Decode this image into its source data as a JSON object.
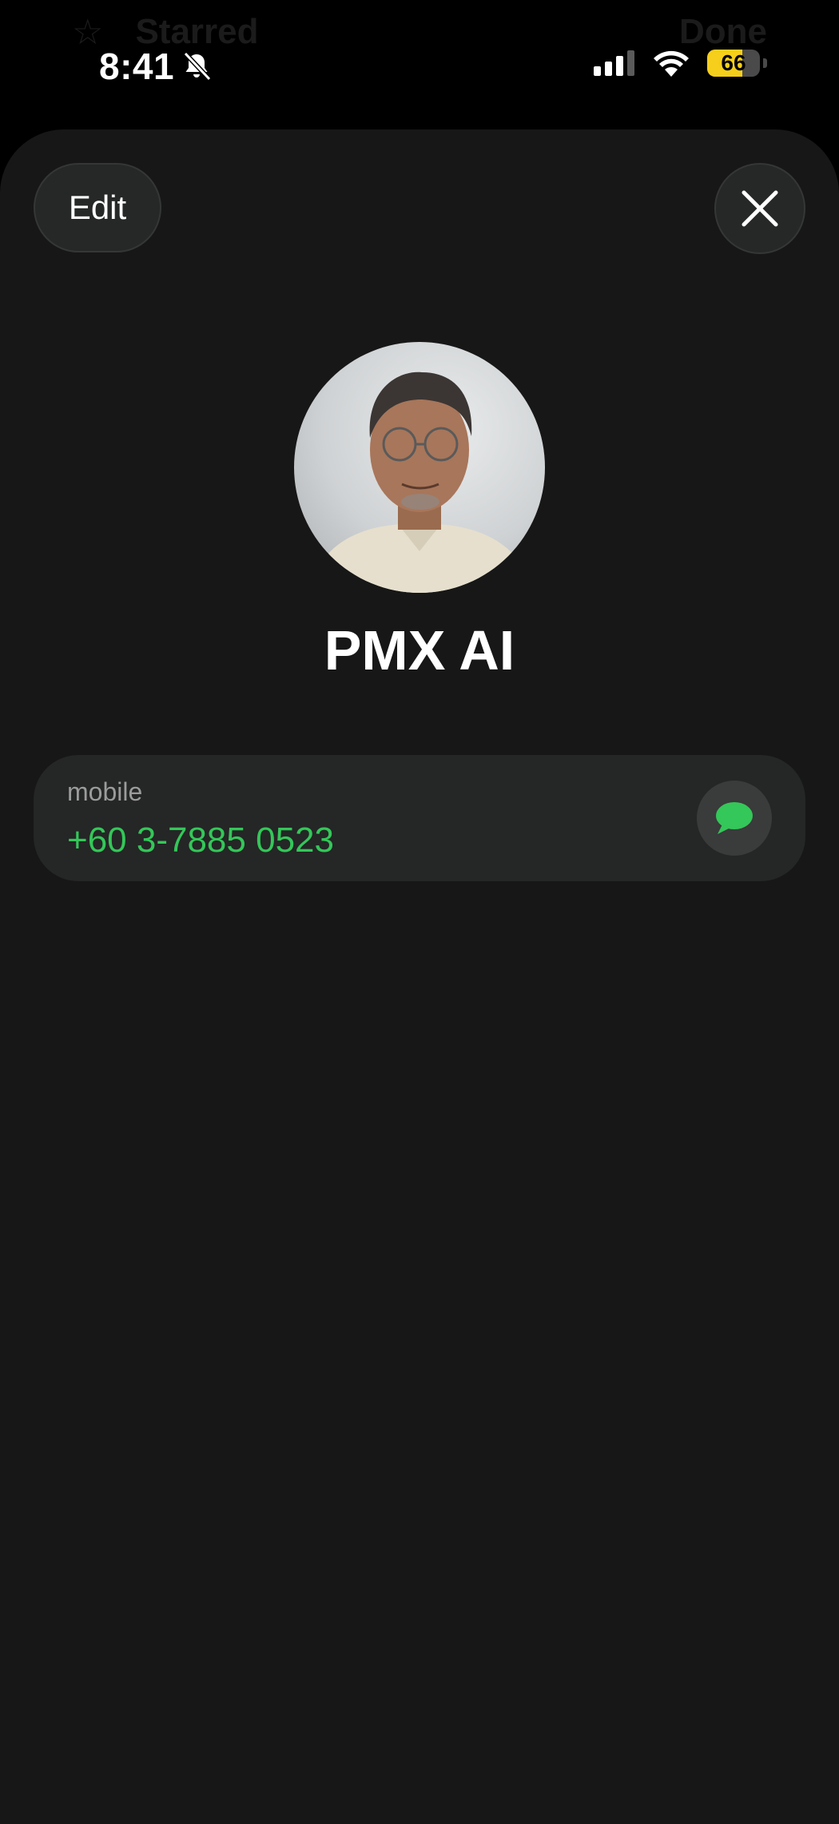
{
  "status_bar": {
    "time": "8:41",
    "battery_level": "66",
    "battery_fraction": 0.66,
    "ghost_title": "Starred",
    "ghost_right": "Done"
  },
  "sheet": {
    "edit_label": "Edit",
    "close_icon": "close-icon"
  },
  "contact": {
    "name": "PMX AI",
    "phone": {
      "label": "mobile",
      "number": "+60 3-7885 0523",
      "action_icon": "message-bubble-icon"
    }
  },
  "colors": {
    "background": "#000000",
    "sheet": "#171717",
    "card": "#252626",
    "accent_green": "#34c759",
    "battery_yellow": "#f5cf1b"
  }
}
